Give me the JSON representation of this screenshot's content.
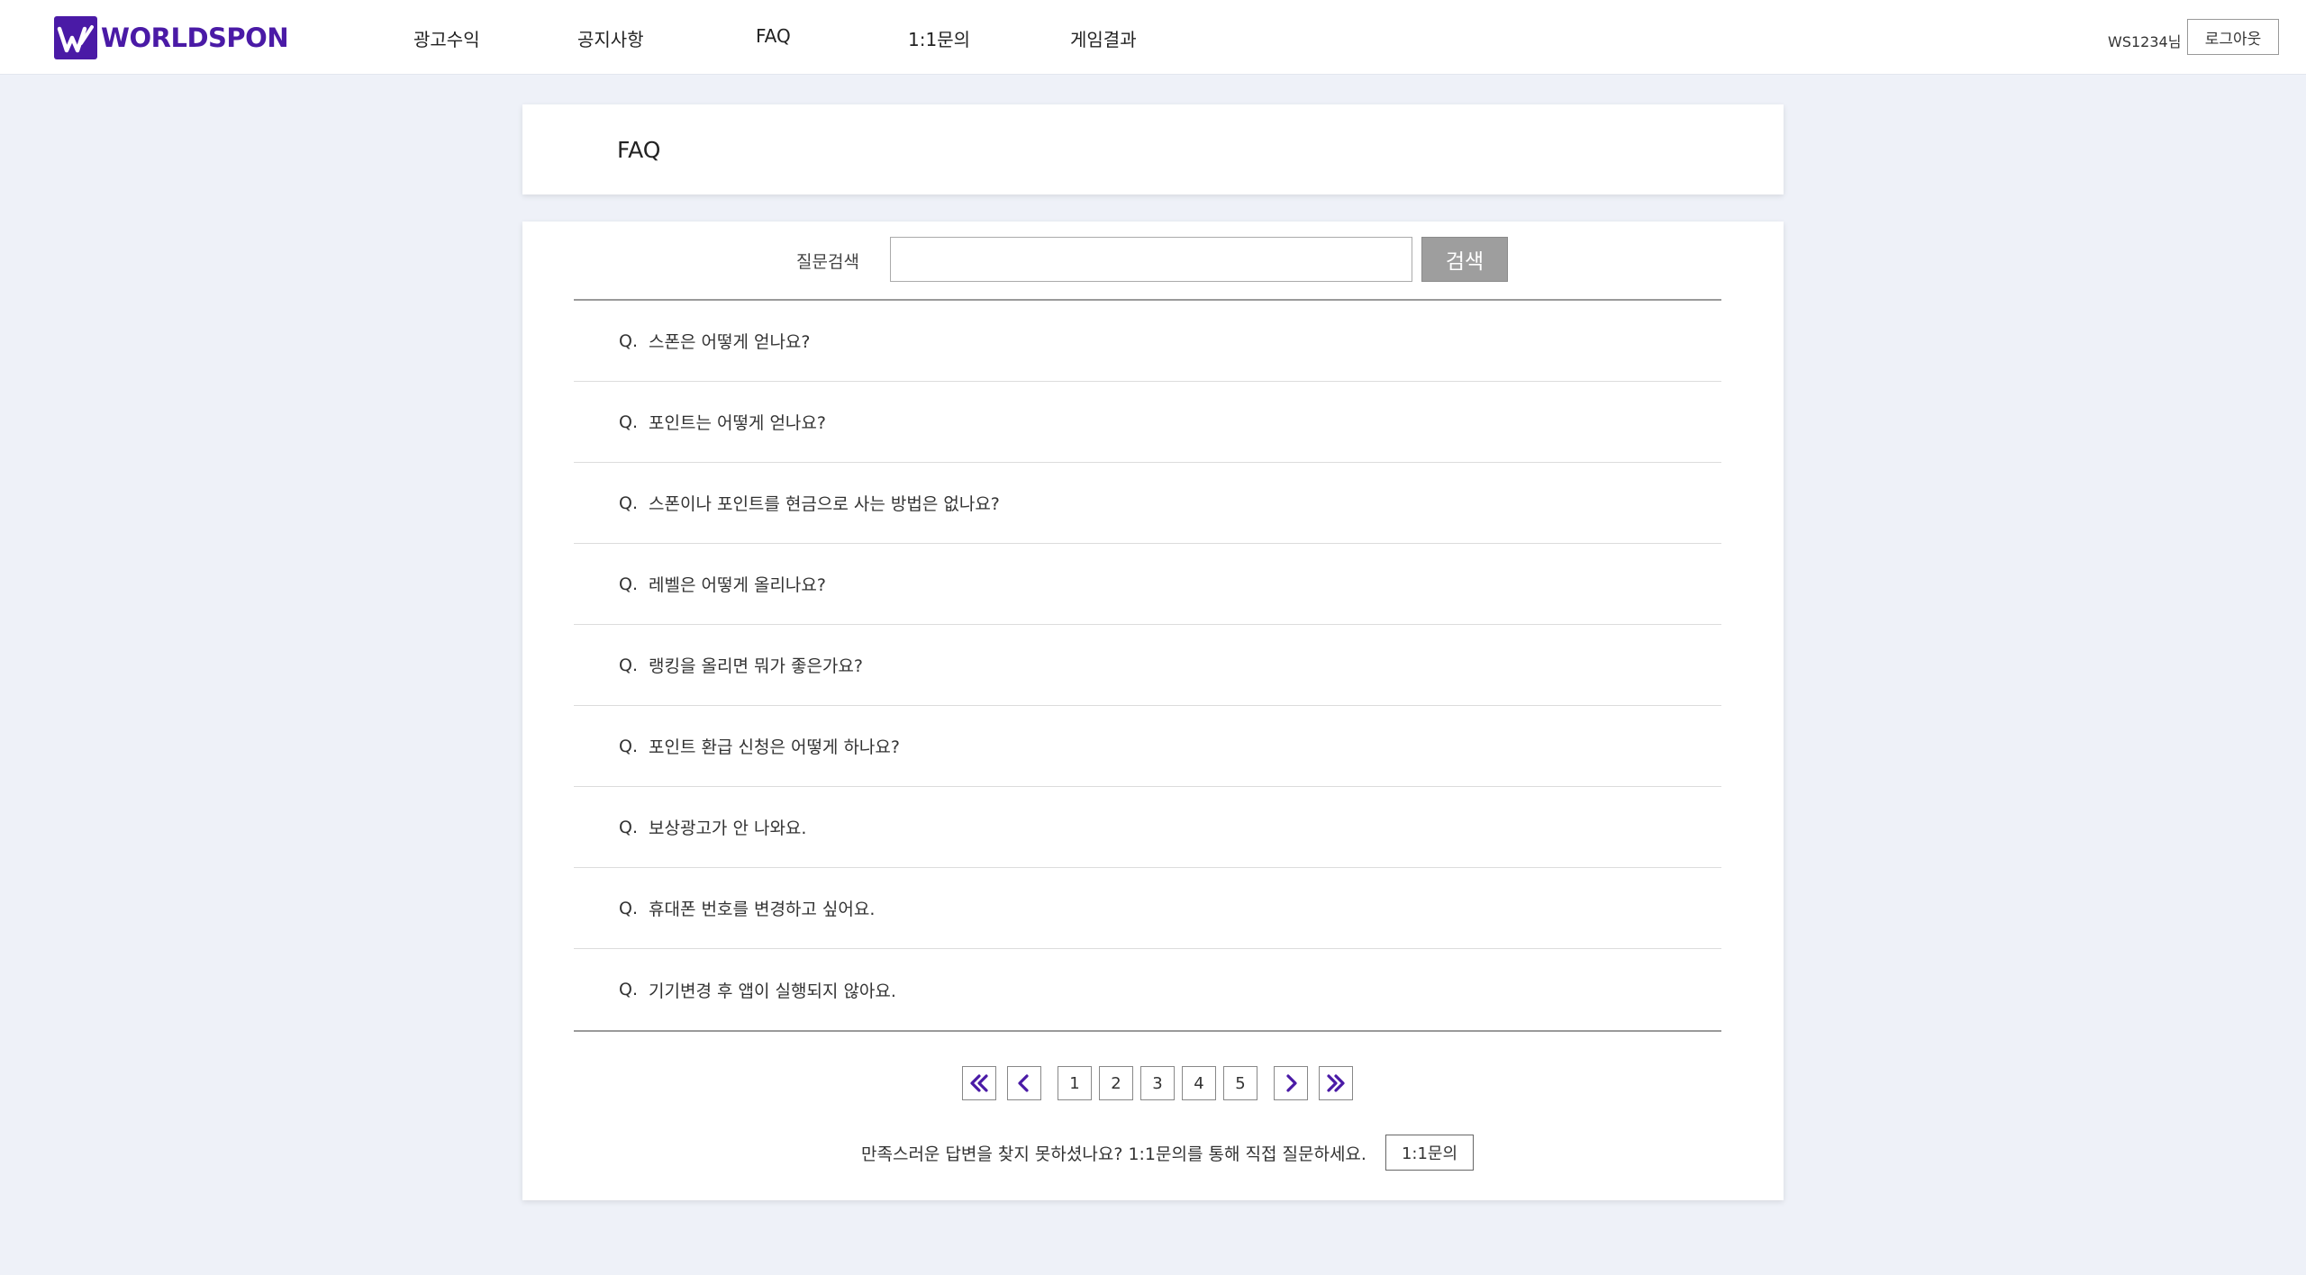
{
  "header": {
    "logo_text": "WORLDSPON",
    "brand_color": "#4a1aa6",
    "nav": [
      {
        "label": "광고수익"
      },
      {
        "label": "공지사항"
      },
      {
        "label": "FAQ"
      },
      {
        "label": "1:1문의"
      },
      {
        "label": "게임결과"
      }
    ],
    "user_name": "WS1234님",
    "logout_label": "로그아웃"
  },
  "page": {
    "title": "FAQ"
  },
  "search": {
    "label": "질문검색",
    "value": "",
    "button_label": "검색"
  },
  "faq": {
    "prefix": "Q.",
    "items": [
      {
        "question": "스폰은 어떻게 얻나요?"
      },
      {
        "question": "포인트는 어떻게 얻나요?"
      },
      {
        "question": "스폰이나 포인트를 현금으로 사는 방법은 없나요?"
      },
      {
        "question": "레벨은 어떻게 올리나요?"
      },
      {
        "question": "랭킹을 올리면 뭐가 좋은가요?"
      },
      {
        "question": "포인트 환급 신청은 어떻게 하나요?"
      },
      {
        "question": "보상광고가 안 나와요."
      },
      {
        "question": "휴대폰 번호를 변경하고 싶어요."
      },
      {
        "question": "기기변경 후 앱이 실행되지 않아요."
      }
    ]
  },
  "pagination": {
    "pages": [
      "1",
      "2",
      "3",
      "4",
      "5"
    ],
    "icons": {
      "first": "double-chevron-left-icon",
      "prev": "chevron-left-icon",
      "next": "chevron-right-icon",
      "last": "double-chevron-right-icon"
    }
  },
  "footer_help": {
    "text": "만족스러운 답변을 찾지 못하셨나요? 1:1문의를 통해 직접 질문하세요.",
    "button_label": "1:1문의"
  }
}
